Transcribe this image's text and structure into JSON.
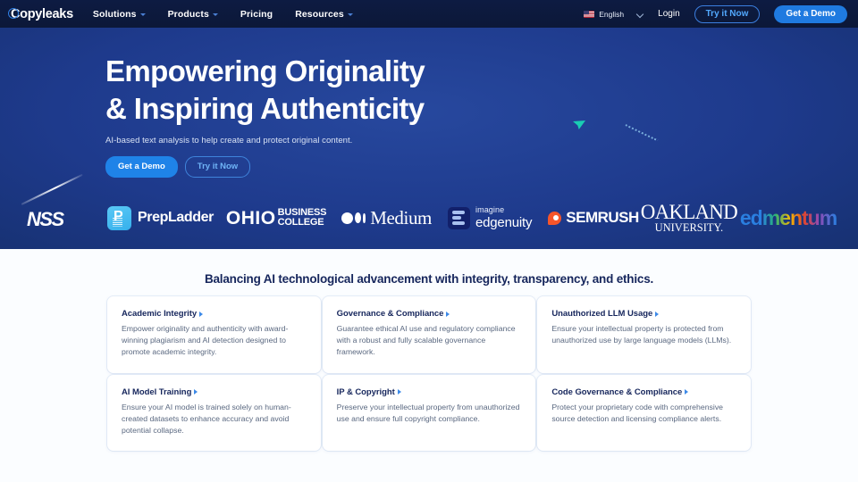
{
  "navbar": {
    "brand": "Copyleaks",
    "links": [
      {
        "label": "Solutions",
        "caret": true
      },
      {
        "label": "Products",
        "caret": true
      },
      {
        "label": "Pricing",
        "caret": false
      },
      {
        "label": "Resources",
        "caret": true
      }
    ],
    "language": "English",
    "login": "Login",
    "try_now": "Try it Now",
    "get_demo": "Get a Demo"
  },
  "hero": {
    "title_line1": "Empowering Originality",
    "title_line2": "& Inspiring Authenticity",
    "subtitle": "AI-based text analysis to help create and protect original content.",
    "btn_demo": "Get a Demo",
    "btn_try": "Try it Now",
    "bg_color": "#1e3a8c",
    "accent_color": "#1f83e8",
    "decoration_teal": "#19d6b4"
  },
  "logos": [
    {
      "name": "NSS",
      "text": "NSS"
    },
    {
      "name": "PrepLadder",
      "text": "PrepLadder"
    },
    {
      "name": "Ohio Business College",
      "line1": "OHIO",
      "line2": "BUSINESS",
      "line3": "COLLEGE"
    },
    {
      "name": "Medium",
      "text": "Medium"
    },
    {
      "name": "Imagine Edgenuity",
      "line1": "imagine",
      "line2": "edgenuity"
    },
    {
      "name": "Semrush",
      "text": "SEMRUSH"
    },
    {
      "name": "Oakland University",
      "line1": "OAKLAND",
      "line2": "UNIVERSITY."
    },
    {
      "name": "Edmentum",
      "text": "edmentum"
    }
  ],
  "section": {
    "title": "Balancing AI technological advancement with integrity, transparency, and ethics.",
    "cards": [
      {
        "title": "Academic Integrity",
        "desc": "Empower originality and authenticity with award-winning plagiarism and AI detection designed to promote academic integrity."
      },
      {
        "title": "Governance & Compliance",
        "desc": "Guarantee ethical AI use and regulatory compliance with a robust and fully scalable governance framework."
      },
      {
        "title": "Unauthorized LLM Usage",
        "desc": "Ensure your intellectual property is protected from unauthorized use by large language models (LLMs)."
      },
      {
        "title": "AI Model Training",
        "desc": "Ensure your AI model is trained solely on human-created datasets to enhance accuracy and avoid potential collapse."
      },
      {
        "title": "IP & Copyright",
        "desc": "Preserve your intellectual property from unauthorized use and ensure full copyright compliance."
      },
      {
        "title": "Code Governance & Compliance",
        "desc": "Protect your proprietary code with comprehensive source detection and licensing compliance alerts."
      }
    ]
  }
}
